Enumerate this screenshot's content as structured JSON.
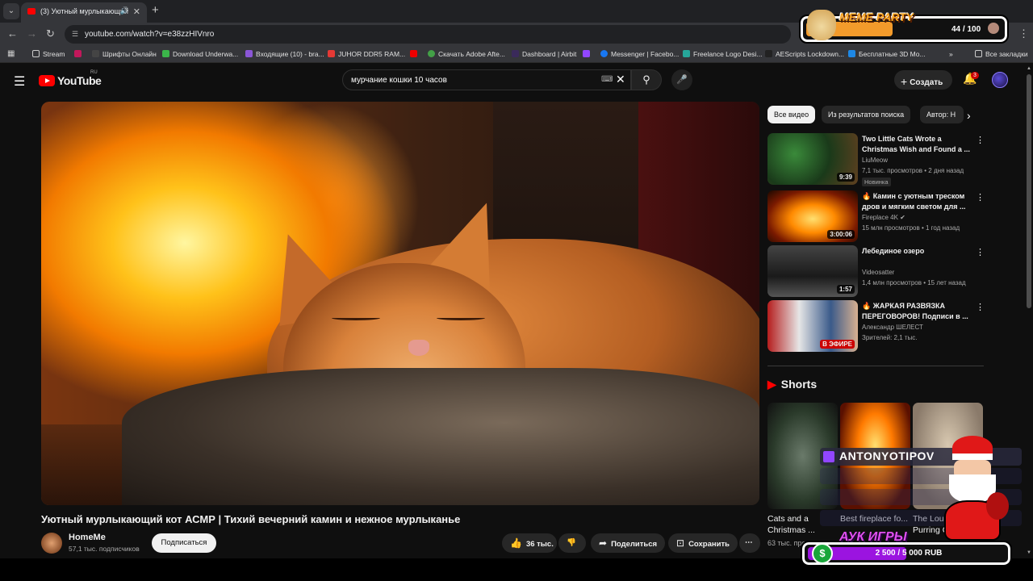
{
  "browser": {
    "tab_title": "(3) Уютный мурлыкающий",
    "url": "youtube.com/watch?v=e38zzHIVnro",
    "bookmarks": [
      "Stream",
      "Шрифты Онлайн",
      "Download Underwa...",
      "Входящие (10) - bra...",
      "JUHOR DDR5 RAM...",
      "Скачать Adobe Afte...",
      "Dashboard | Airbit",
      "Messenger | Facebo...",
      "Freelance Logo Desi...",
      "AEScripts Lockdown...",
      "Бесплатные 3D Mo..."
    ],
    "all_bookmarks": "Все закладки"
  },
  "youtube": {
    "logo_text": "YouTube",
    "logo_region": "RU",
    "search_query": "мурчание кошки 10 часов",
    "create_label": "Создать",
    "notif_count": "3"
  },
  "video": {
    "title": "Уютный мурлыкающий кот АСМР | Тихий вечерний камин и нежное мурлыканье",
    "channel": "HomeMe",
    "subscribers": "57,1 тыс. подписчиков",
    "subscribe_label": "Подписаться",
    "likes": "36 тыс.",
    "share_label": "Поделиться",
    "save_label": "Сохранить"
  },
  "chips": [
    "Все видео",
    "Из результатов поиска",
    "Автор: H"
  ],
  "recommendations": [
    {
      "title": "Two Little Cats Wrote a Christmas Wish and Found a ...",
      "channel": "LiuMeow",
      "meta": "7,1 тыс. просмотров • 2 дня назад",
      "duration": "9:39",
      "badge": "Новинка"
    },
    {
      "title": "🔥 Камин с уютным треском дров и мягким светом для ...",
      "channel": "Fireplace 4K ✔",
      "meta": "15 млн просмотров • 1 год назад",
      "duration": "3:00:06",
      "badge": ""
    },
    {
      "title": "Лебединое озеро",
      "channel": "Videosatter",
      "meta": "1,4 млн просмотров • 15 лет назад",
      "duration": "1:57",
      "badge": ""
    },
    {
      "title": "🔥 ЖАРКАЯ РАЗВЯЗКА ПЕРЕГОВОРОВ! Подписи в ...",
      "channel": "Александр ШЕЛЕСТ",
      "meta": "Зрителей: 2,1 тыс.",
      "duration": "В ЭФИРЕ",
      "badge": ""
    }
  ],
  "shorts": {
    "title": "Shorts",
    "items": [
      {
        "caption": "Cats and a Christmas ...",
        "meta": "63 тыс. просмотр..."
      },
      {
        "caption": "Best fireplace fo...",
        "meta": ""
      },
      {
        "caption": "The Loude... Purring Cat...",
        "meta": ""
      }
    ]
  },
  "overlays": {
    "meme_title": "MEME PARTY",
    "meme_count": "44 / 100",
    "meme_progress": 0.44,
    "auk_title": "АУК ИГРЫ",
    "auk_value": "2 500 / 5 000 RUB",
    "auk_progress": 0.5,
    "twitch_name": "ANTONYOTIPOV"
  },
  "colors": {
    "youtube_red": "#ff0000",
    "meme_orange": "#f39b2b",
    "auk_purple": "#9b14e0",
    "twitch_purple": "#9146ff"
  }
}
